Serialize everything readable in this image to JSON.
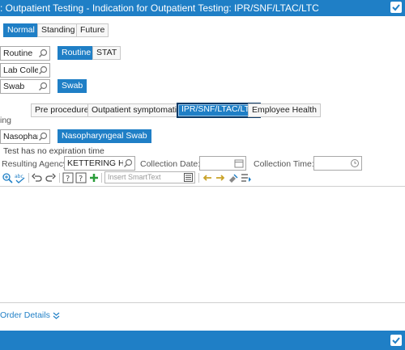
{
  "window": {
    "title": ": Outpatient Testing - Indication for Outpatient Testing: IPR/SNF/LTAC/LTC"
  },
  "status_options": {
    "normal": "Normal",
    "standing": "Standing",
    "future": "Future"
  },
  "priority": {
    "value": "Routine",
    "routine_label": "Routine",
    "stat_label": "STAT"
  },
  "collection": {
    "value": "Lab Collect"
  },
  "specimen": {
    "value": "Swab",
    "swab_label": "Swab"
  },
  "indication": {
    "label_partial": "ing",
    "options": [
      "Pre procedure",
      "Outpatient symptomatic",
      "IPR/SNF/LTAC/LTC",
      "Employee Health"
    ]
  },
  "source": {
    "value": "Nasopharyngeal Swab",
    "option_label": "Nasopharyngeal Swab"
  },
  "expiration_text": "Test has no expiration time",
  "resulting_agency": {
    "label": "Resulting Agency:",
    "value": "KETTERING HEALTH"
  },
  "collection_date": {
    "label": "Collection Date:",
    "value": ""
  },
  "collection_time": {
    "label": "Collection Time:",
    "value": ""
  },
  "smarttext": {
    "placeholder": "Insert SmartText"
  },
  "order_details": {
    "label": "Order Details"
  },
  "colors": {
    "accent": "#1f7fc6",
    "title_bg": "#1f7fc6"
  },
  "icons": [
    "magnifier-icon",
    "calendar-icon",
    "clock-icon",
    "spell-check-icon",
    "undo-icon",
    "redo-icon",
    "help-icon",
    "add-icon",
    "arrow-left-icon",
    "arrow-right-icon",
    "checkmark-icon"
  ]
}
